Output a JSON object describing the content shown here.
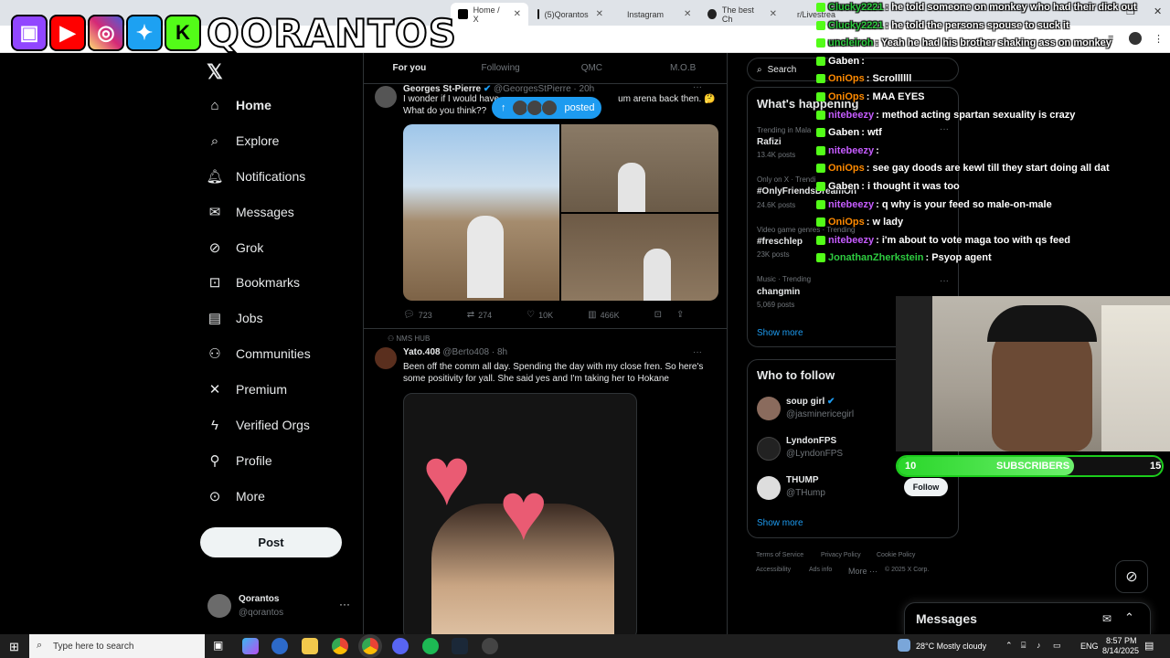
{
  "browser": {
    "tabs": [
      {
        "label": "Home / X",
        "active": true
      },
      {
        "label": "(5)Qorantos",
        "active": false
      },
      {
        "label": "Instagram",
        "active": false
      },
      {
        "label": "The best Ch",
        "active": false
      },
      {
        "label": "r/Livestrea",
        "active": false
      }
    ]
  },
  "overlay": {
    "brand": "QORANTOS"
  },
  "nav": {
    "items": [
      {
        "label": "Home",
        "icon": "home-icon"
      },
      {
        "label": "Explore",
        "icon": "search-icon"
      },
      {
        "label": "Notifications",
        "icon": "bell-icon"
      },
      {
        "label": "Messages",
        "icon": "envelope-icon"
      },
      {
        "label": "Grok",
        "icon": "grok-icon"
      },
      {
        "label": "Bookmarks",
        "icon": "bookmark-icon"
      },
      {
        "label": "Jobs",
        "icon": "briefcase-icon"
      },
      {
        "label": "Communities",
        "icon": "people-icon"
      },
      {
        "label": "Premium",
        "icon": "x-icon"
      },
      {
        "label": "Verified Orgs",
        "icon": "lightning-icon"
      },
      {
        "label": "Profile",
        "icon": "person-icon"
      },
      {
        "label": "More",
        "icon": "more-icon"
      }
    ],
    "post_label": "Post",
    "account": {
      "name": "Qorantos",
      "handle": "@qorantos"
    }
  },
  "feed": {
    "tabs": [
      "For you",
      "Following",
      "QMC",
      "M.O.B"
    ],
    "posted_pill": "posted",
    "tweet1": {
      "name": "Georges St-Pierre",
      "handle": "@GeorgesStPierre · 20h",
      "text_line1": "I wonder if I would have",
      "text_line1_end": "um arena back then. 🤔",
      "text_line2": "What do you think??",
      "replies": "723",
      "reposts": "274",
      "likes": "10K",
      "views": "466K"
    },
    "tweet2": {
      "context": "NMS HUB",
      "name": "Yato.408",
      "handle": "@Berto408 · 8h",
      "text": "Been off the comm all day. Spending the day with my close fren. So here's some positivity for yall. She said yes and I'm taking her to Hokane"
    }
  },
  "sidebar": {
    "search_placeholder": "Search",
    "whats_happening": "What's happening",
    "trends": [
      {
        "meta": "Trending in Mala",
        "name": "Rafizi",
        "count": "13.4K posts"
      },
      {
        "meta": "Only on X · Trendi",
        "name": "#OnlyFriendsDreamOn",
        "count": "24.6K posts"
      },
      {
        "meta": "Video game genres · Trending",
        "name": "#freschlep",
        "count": "23K posts"
      },
      {
        "meta": "Music · Trending",
        "name": "changmin",
        "count": "5,069 posts"
      }
    ],
    "show_more": "Show more",
    "who_to_follow": "Who to follow",
    "follow_suggestions": [
      {
        "name": "soup girl",
        "handle": "@jasminericegirl"
      },
      {
        "name": "LyndonFPS",
        "handle": "@LyndonFPS"
      },
      {
        "name": "THUMP",
        "handle": "@THump"
      }
    ],
    "follow_label": "Follow",
    "footer": [
      "Terms of Service",
      "Privacy Policy",
      "Cookie Policy",
      "Accessibility",
      "Ads info",
      "More ···",
      "© 2025 X Corp."
    ]
  },
  "chat": [
    {
      "user": "Clucky2221",
      "text": ": he told someone on monkey who had their dick out",
      "color": "#2ecc40"
    },
    {
      "user": "Clucky2221",
      "text": ": he told the persons spouse to suck it",
      "color": "#2ecc40"
    },
    {
      "user": "uncleiroh",
      "text": ": Yeah he had his brother shaking ass on monkey",
      "color": "#2ecc40"
    },
    {
      "user": "Gaben",
      "text": ":",
      "color": "#ffffff"
    },
    {
      "user": "OniOps",
      "text": ": Scrollllll",
      "color": "#ff8a00"
    },
    {
      "user": "OniOps",
      "text": ": MAA EYES",
      "color": "#ff8a00"
    },
    {
      "user": "nitebeezy",
      "text": ": method acting spartan sexuality is crazy",
      "color": "#c65cff"
    },
    {
      "user": "Gaben",
      "text": ": wtf",
      "color": "#ffffff"
    },
    {
      "user": "nitebeezy",
      "text": ":",
      "color": "#c65cff"
    },
    {
      "user": "OniOps",
      "text": ": see gay doods are kewl till they start doing all dat",
      "color": "#ff8a00"
    },
    {
      "user": "Gaben",
      "text": ": i thought it was too",
      "color": "#ffffff"
    },
    {
      "user": "nitebeezy",
      "text": ": q why is your feed so male-on-male",
      "color": "#c65cff"
    },
    {
      "user": "OniOps",
      "text": ": w lady",
      "color": "#ff8a00"
    },
    {
      "user": "nitebeezy",
      "text": ": i'm about to vote maga too with qs feed",
      "color": "#c65cff"
    },
    {
      "user": "JonathanZherkstein",
      "text": ": Psyop agent",
      "color": "#2ecc40"
    }
  ],
  "subgoal": {
    "current": "10",
    "label": "SUBSCRIBERS",
    "goal": "15",
    "progress": 0.667
  },
  "messages_drawer": "Messages",
  "taskbar": {
    "search_placeholder": "Type here to search",
    "weather": "28°C  Mostly cloudy",
    "lang": "ENG",
    "time": "8:57 PM",
    "date": "8/14/2025"
  }
}
